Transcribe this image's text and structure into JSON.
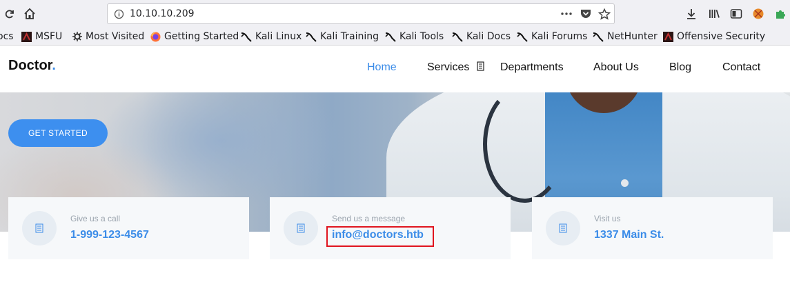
{
  "browser": {
    "url": "10.10.10.209",
    "icons": [
      "reload-icon",
      "home-icon",
      "info-icon",
      "more-icon",
      "pocket-icon",
      "star-icon",
      "download-icon",
      "library-icon",
      "sidebar-icon",
      "extension-icon",
      "puzzle-icon"
    ],
    "bookmarks": [
      {
        "label": "ocs",
        "icon": "none"
      },
      {
        "label": "MSFU",
        "icon": "offsec-icon"
      },
      {
        "label": "Most Visited",
        "icon": "gear-icon"
      },
      {
        "label": "Getting Started",
        "icon": "firefox-icon"
      },
      {
        "label": "Kali Linux",
        "icon": "kali-icon"
      },
      {
        "label": "Kali Training",
        "icon": "kali-icon"
      },
      {
        "label": "Kali Tools",
        "icon": "kali-icon"
      },
      {
        "label": "Kali Docs",
        "icon": "kali-icon"
      },
      {
        "label": "Kali Forums",
        "icon": "kali-icon"
      },
      {
        "label": "NetHunter",
        "icon": "kali-icon"
      },
      {
        "label": "Offensive Security",
        "icon": "offsec-icon"
      }
    ]
  },
  "site": {
    "brand": "Doctor",
    "brand_dot": ".",
    "accent": "#3b8ce8",
    "nav": {
      "home": "Home",
      "services": "Services",
      "departments": "Departments",
      "about": "About Us",
      "blog": "Blog",
      "contact": "Contact"
    },
    "cta_label": "GET STARTED"
  },
  "cards": {
    "call": {
      "label": "Give us a call",
      "value": "1-999-123-4567"
    },
    "message": {
      "label": "Send us a message",
      "value": "info@doctors.htb"
    },
    "visit": {
      "label": "Visit us",
      "value": "1337 Main St."
    }
  }
}
